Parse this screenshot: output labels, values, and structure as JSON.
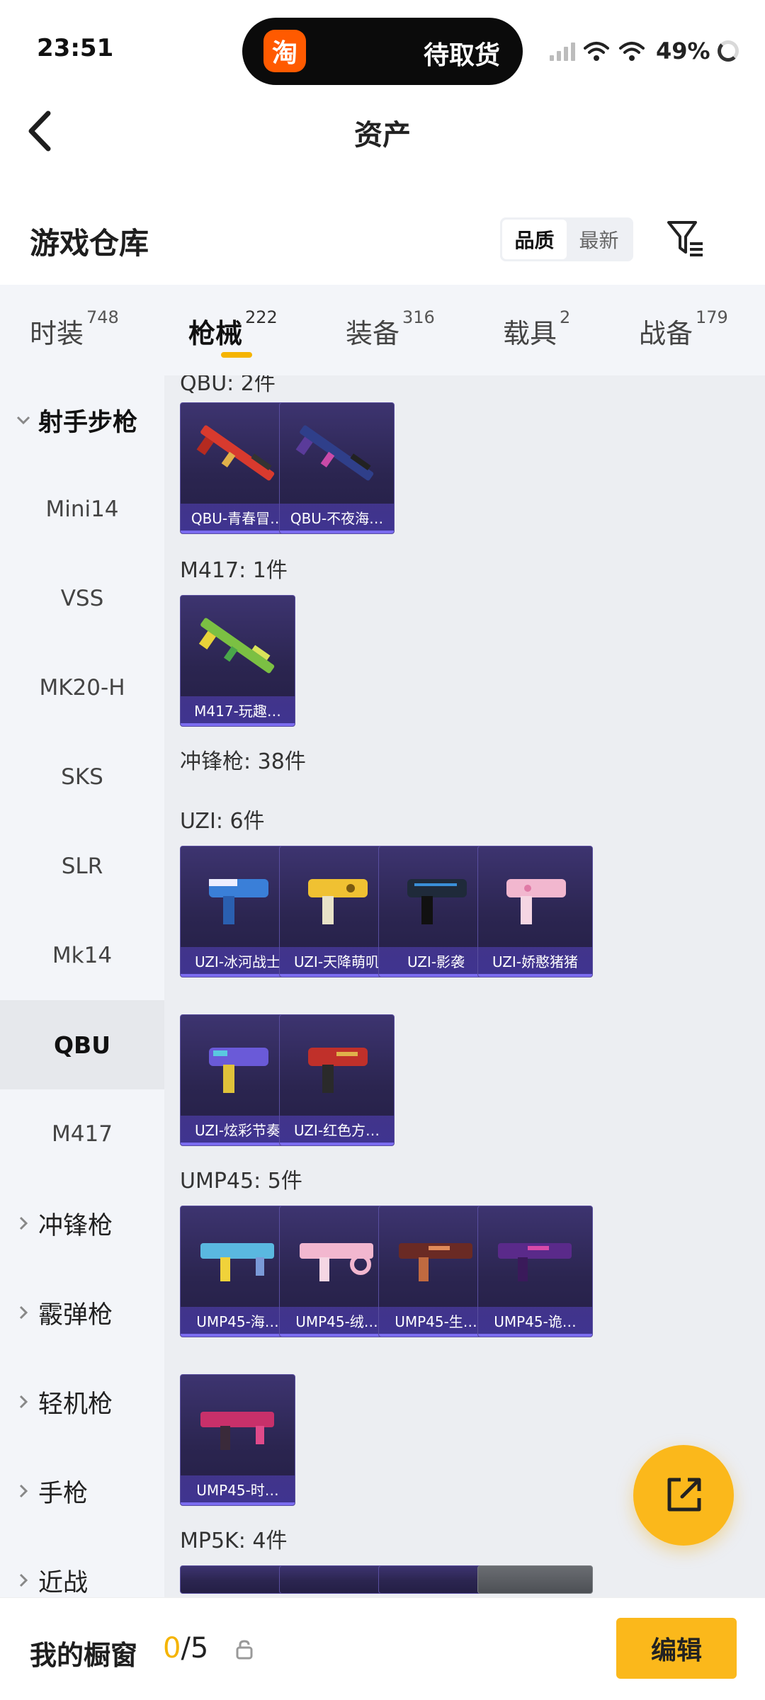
{
  "status_bar": {
    "time": "23:51",
    "app_icon_char": "淘",
    "pill_text": "待取货",
    "battery": "49%"
  },
  "header": {
    "title": "资产"
  },
  "section": {
    "title": "游戏仓库",
    "sort_quality": "品质",
    "sort_latest": "最新"
  },
  "tabs": [
    {
      "label": "时装",
      "count": "748"
    },
    {
      "label": "枪械",
      "count": "222"
    },
    {
      "label": "装备",
      "count": "316"
    },
    {
      "label": "载具",
      "count": "2"
    },
    {
      "label": "战备",
      "count": "179"
    }
  ],
  "sidebar": {
    "items": [
      {
        "label": "射手步枪"
      },
      {
        "label": "Mini14"
      },
      {
        "label": "VSS"
      },
      {
        "label": "MK20-H"
      },
      {
        "label": "SKS"
      },
      {
        "label": "SLR"
      },
      {
        "label": "Mk14"
      },
      {
        "label": "QBU"
      },
      {
        "label": "M417"
      },
      {
        "label": "冲锋枪"
      },
      {
        "label": "霰弹枪"
      },
      {
        "label": "轻机枪"
      },
      {
        "label": "手枪"
      },
      {
        "label": "近战"
      }
    ]
  },
  "content": {
    "qbu_label": "QBU: 2件",
    "m417_label": "M417: 1件",
    "smg_label": "冲锋枪: 38件",
    "uzi_label": "UZI: 6件",
    "ump_label": "UMP45: 5件",
    "mp5k_label": "MP5K: 4件",
    "cards": {
      "qbu": [
        "QBU-青春冒…",
        "QBU-不夜海…"
      ],
      "m417": [
        "M417-玩趣…"
      ],
      "uzi": [
        "UZI-冰河战士",
        "UZI-天降萌叽",
        "UZI-影袭",
        "UZI-娇憨猪猪",
        "UZI-炫彩节奏",
        "UZI-红色方…"
      ],
      "ump": [
        "UMP45-海…",
        "UMP45-绒…",
        "UMP45-生…",
        "UMP45-诡…",
        "UMP45-时…"
      ]
    }
  },
  "bottom_bar": {
    "title": "我的橱窗",
    "count_current": "0",
    "count_sep_total": "/5",
    "edit_label": "编辑"
  },
  "colors": {
    "accent": "#fbb81b",
    "card_bg": "#2b2550",
    "sidebar_bg": "#f3f5f9",
    "content_bg": "#eceef2"
  },
  "icons": [
    "back-icon",
    "filter-icon",
    "chevron-down-icon",
    "chevron-right-icon",
    "share-icon",
    "lock-icon",
    "wifi-icon",
    "signal-icon",
    "battery-icon"
  ]
}
